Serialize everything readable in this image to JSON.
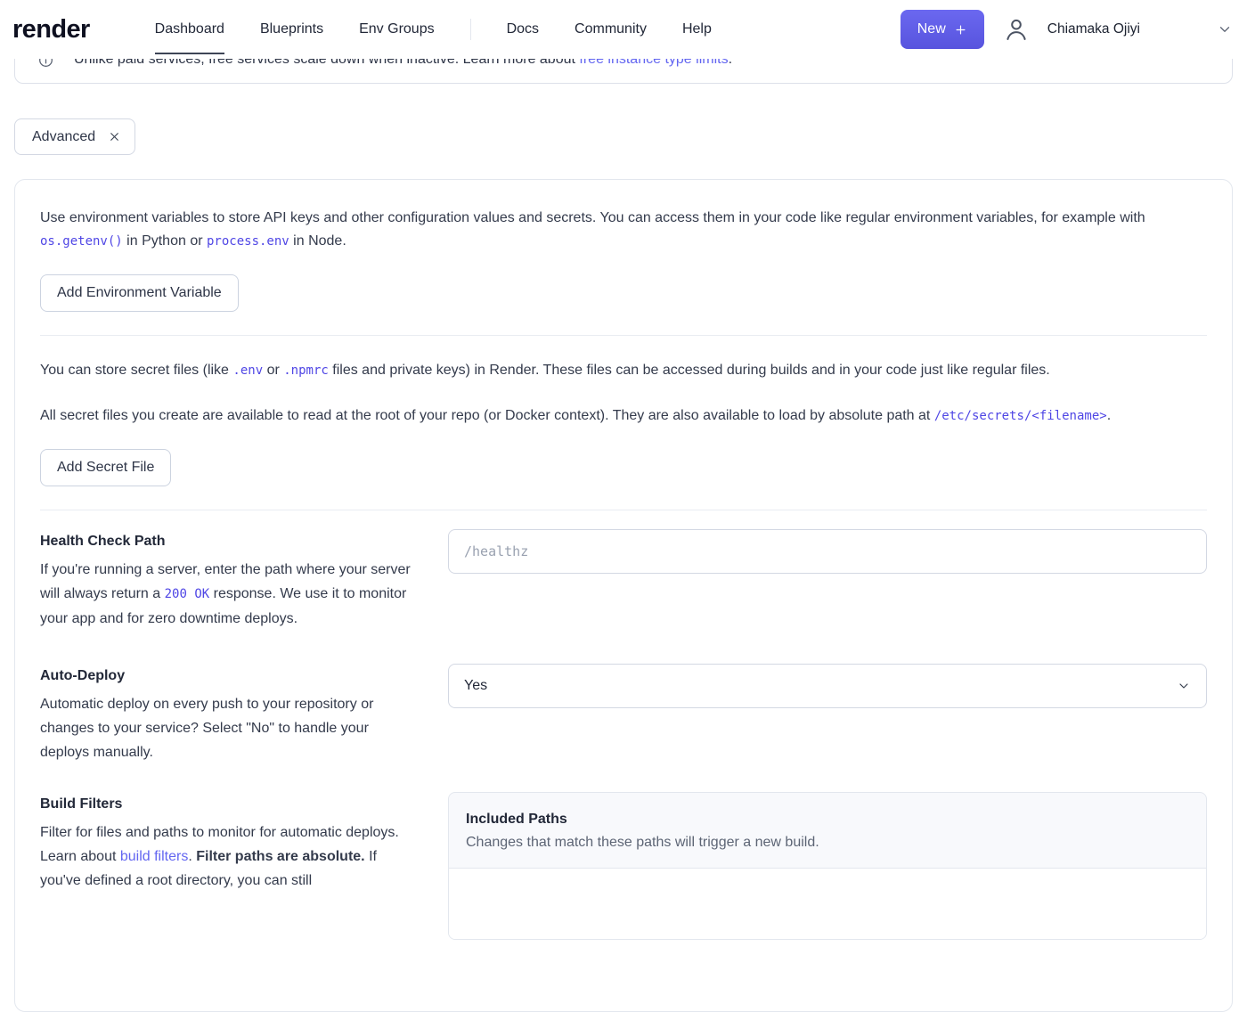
{
  "navbar": {
    "logo": "render",
    "items": [
      "Dashboard",
      "Blueprints",
      "Env Groups",
      "Docs",
      "Community",
      "Help"
    ],
    "new_button_label": "New",
    "user_name": "Chiamaka Ojiyi"
  },
  "banner": {
    "text": "Unlike paid services, free services scale down when inactive. Learn more about ",
    "link_text": "free instance type limits",
    "suffix": "."
  },
  "filter_chip": {
    "label": "Advanced"
  },
  "env_vars": {
    "p1_a": "Use environment variables to store API keys and other configuration values and secrets. You can access them in your code like regular environment variables, for example with ",
    "p1_code1": "os.getenv()",
    "p1_b": " in Python or ",
    "p1_code2": "process.env",
    "p1_c": " in Node.",
    "add_button_label": "Add Environment Variable"
  },
  "secret_files": {
    "p1_a": "You can store secret files (like ",
    "p1_code1": ".env",
    "p1_b": " or ",
    "p1_code2": ".npmrc",
    "p1_c": " files and private keys) in Render. These files can be accessed during builds and in your code just like regular files.",
    "p2_a": "All secret files you create are available to read at the root of your repo (or Docker context). They are also available to load by absolute path at ",
    "p2_code": "/etc/secrets/<filename>",
    "p2_b": ".",
    "add_button_label": "Add Secret File"
  },
  "health_check": {
    "label": "Health Check Path",
    "desc_a": "If you're running a server, enter the path where your server will always return a ",
    "desc_code": "200 OK",
    "desc_b": " response. We use it to monitor your app and for zero downtime deploys.",
    "input_placeholder": "/healthz"
  },
  "auto_deploy": {
    "label": "Auto-Deploy",
    "desc": "Automatic deploy on every push to your repository or changes to your service? Select \"No\" to handle your deploys manually.",
    "selected_value": "Yes"
  },
  "build_filters": {
    "label": "Build Filters",
    "desc_a": "Filter for files and paths to monitor for automatic deploys. Learn about ",
    "desc_link": "build filters",
    "desc_b": ". ",
    "desc_bold": "Filter paths are absolute.",
    "desc_c": " If you've defined a root directory, you can still",
    "included_paths": {
      "title": "Included Paths",
      "desc": "Changes that match these paths will trigger a new build."
    }
  },
  "colors": {
    "accent": "#5a5ce0",
    "link": "#6366f1"
  }
}
